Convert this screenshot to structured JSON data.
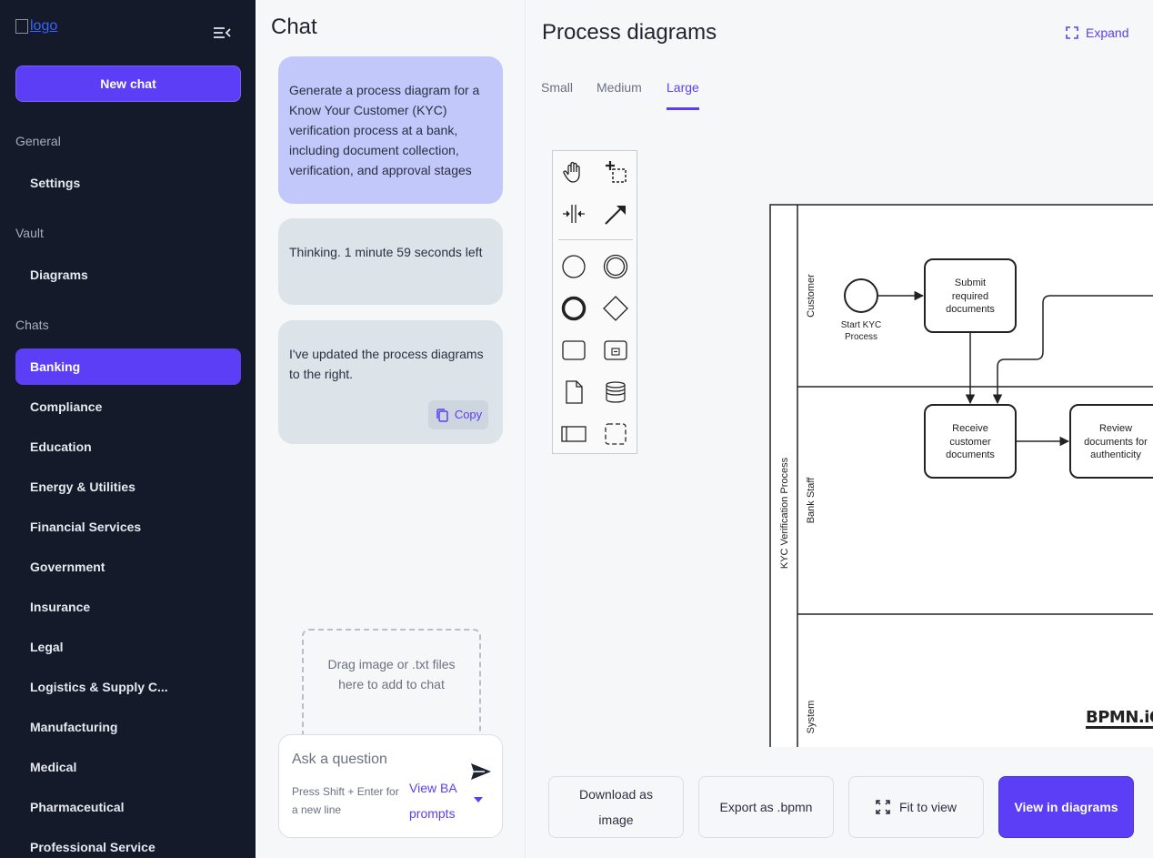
{
  "sidebar": {
    "logo_alt": "logo",
    "new_chat_label": "New chat",
    "sections": {
      "general": "General",
      "vault": "Vault",
      "chats": "Chats"
    },
    "general_items": [
      "Settings"
    ],
    "vault_items": [
      "Diagrams"
    ],
    "chat_items": [
      "Banking",
      "Compliance",
      "Education",
      "Energy & Utilities",
      "Financial Services",
      "Government",
      "Insurance",
      "Legal",
      "Logistics & Supply C...",
      "Manufacturing",
      "Medical",
      "Pharmaceutical",
      "Professional Service"
    ],
    "active_chat": "Banking"
  },
  "chat": {
    "title": "Chat",
    "messages": [
      {
        "role": "user",
        "text": "Generate a process diagram for a Know Your Customer (KYC) verification process at a bank, including document collection, verification, and approval stages"
      },
      {
        "role": "assistant",
        "text": "Thinking. 1 minute 59 seconds left"
      },
      {
        "role": "assistant",
        "text": "I've updated the process diagrams to the right."
      }
    ],
    "copy_label": "Copy",
    "dropzone_text": "Drag image or .txt files here to add to chat",
    "input_placeholder": "Ask a question",
    "hint": "Press Shift + Enter for a new line",
    "ba_prompts_label": "View BA prompts"
  },
  "main": {
    "title": "Process diagrams",
    "expand_label": "Expand",
    "tabs": [
      "Small",
      "Medium",
      "Large"
    ],
    "active_tab": "Large",
    "diagram": {
      "pool": "KYC Verification Process",
      "lanes": [
        "Customer",
        "Bank Staff",
        "System"
      ],
      "start_event": "Start KYC Process",
      "tasks": [
        "Submit required documents",
        "Receive customer documents",
        "Review documents for authenticity"
      ]
    },
    "watermark": "BPMN.iO",
    "buttons": {
      "download": "Download as image",
      "export": "Export as .bpmn",
      "fit": "Fit to view",
      "view": "View in diagrams"
    }
  }
}
